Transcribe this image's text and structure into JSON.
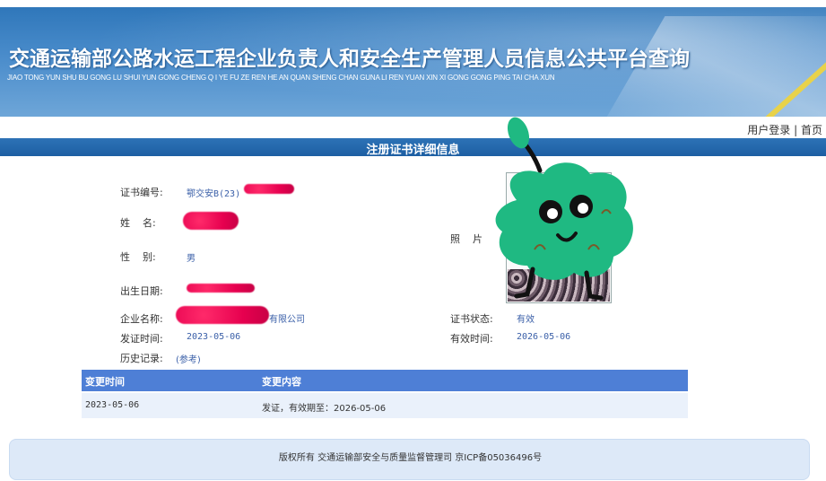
{
  "header": {
    "title": "交通运输部公路水运工程企业负责人和安全生产管理人员信息公共平台查询",
    "subtitle": "JIAO TONG YUN SHU BU GONG LU SHUI YUN GONG CHENG Q I YE FU ZE REN HE AN QUAN SHENG CHAN GUNA LI REN YUAN XIN XI GONG GONG PING TAI CHA XUN"
  },
  "toplinks": {
    "login": "用户登录",
    "separator": " | ",
    "home": "首页"
  },
  "section_title": "注册证书详细信息",
  "fields": {
    "cert_no_label": "证书编号:",
    "cert_no_value": "鄂交安B(23)",
    "name_label": "姓    名:",
    "gender_label": "性    别:",
    "gender_value": "男",
    "birth_label": "出生日期:",
    "company_label": "企业名称:",
    "company_value": "有限公司",
    "issue_label": "发证时间:",
    "issue_value": "2023-05-06",
    "history_label": "历史记录:",
    "history_value": "(参考)",
    "photo_label": "照    片",
    "status_label": "证书状态:",
    "status_value": "有效",
    "valid_label": "有效时间:",
    "valid_value": "2026-05-06"
  },
  "history_table": {
    "headers": [
      "变更时间",
      "变更内容"
    ],
    "rows": [
      [
        "2023-05-06",
        "发证，有效期至：2026-05-06"
      ]
    ]
  },
  "footer": {
    "text": "版权所有 交通运输部安全与质量监督管理司 京ICP备05036496号"
  },
  "colors": {
    "banner": "#2f77ba",
    "title_bar": "#1d5fa3",
    "table_header": "#4e7fd6",
    "table_row": "#eaf1fb",
    "value_text": "#3a5fa8",
    "mascot_green": "#1fb982",
    "redaction": "#e6004f"
  }
}
